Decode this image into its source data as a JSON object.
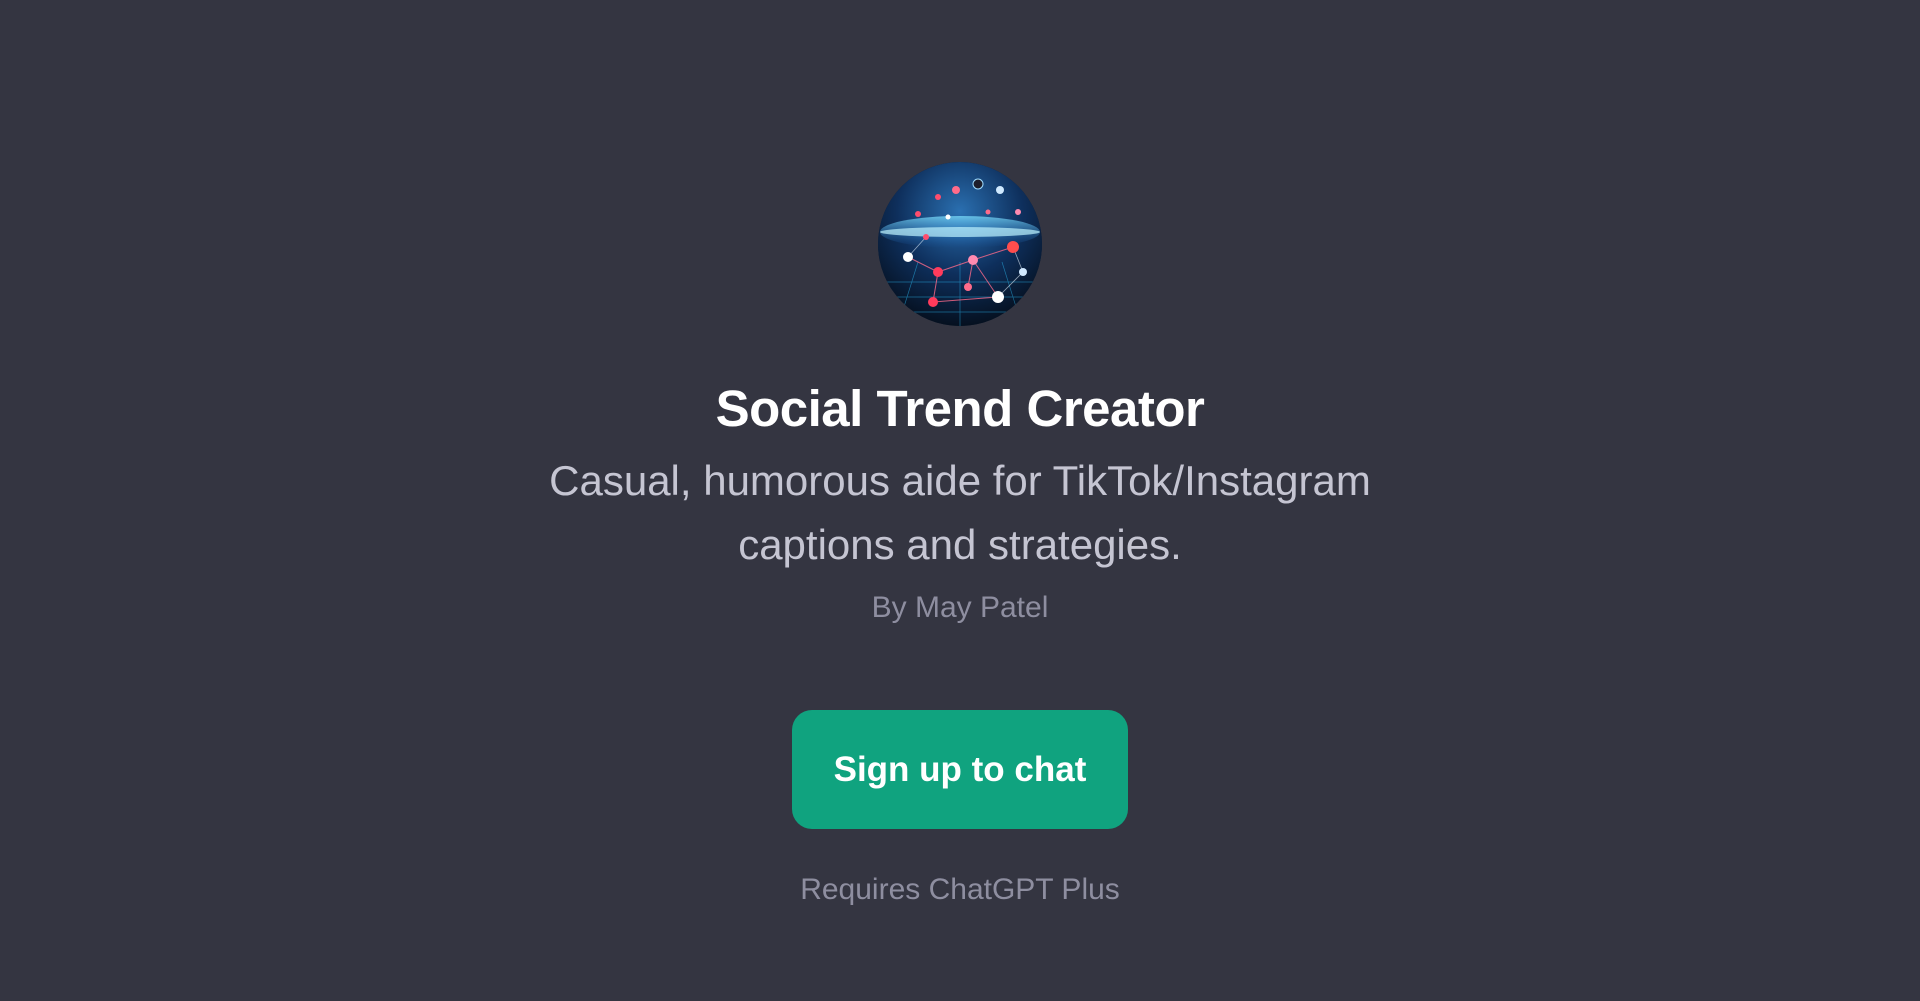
{
  "gpt": {
    "avatar_icon": "globe-network-icon",
    "name": "Social Trend Creator",
    "description_lines": [
      "Casual, humorous aide for TikTok/Instagram",
      "captions and strategies."
    ],
    "author": "By May Patel"
  },
  "cta": {
    "label": "Sign up to chat"
  },
  "requirement": "Requires ChatGPT Plus",
  "colors": {
    "background": "#343541",
    "accent": "#10a37f",
    "title": "#ffffff",
    "description": "#c5c5d2",
    "muted": "#8e8ea0"
  }
}
